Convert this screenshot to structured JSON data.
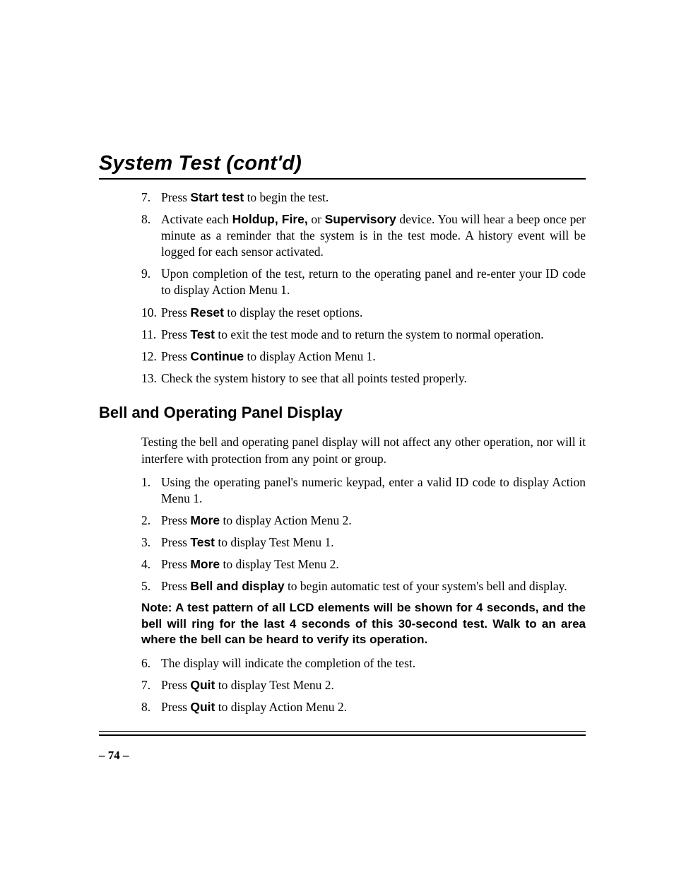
{
  "title": "System Test (cont'd)",
  "list1": {
    "items": [
      {
        "num": "7.",
        "parts": [
          "Press ",
          "Start test",
          " to begin the test."
        ]
      },
      {
        "num": "8.",
        "parts": [
          "Activate each ",
          "Holdup, Fire,",
          " or ",
          "Supervisory",
          " device. You will hear a beep once per minute as a reminder that the system is in the test mode. A history event will be logged for each sensor activated."
        ]
      },
      {
        "num": "9.",
        "parts": [
          "Upon completion of the test, return to the operating panel and re-enter your ID code to display Action Menu 1."
        ]
      },
      {
        "num": "10.",
        "parts": [
          "Press ",
          "Reset",
          " to display the reset options."
        ]
      },
      {
        "num": "11.",
        "parts": [
          "Press ",
          "Test",
          " to exit the test mode and to return the system to normal operation."
        ]
      },
      {
        "num": "12.",
        "parts": [
          "Press ",
          "Continue",
          " to display Action Menu 1."
        ]
      },
      {
        "num": "13.",
        "parts": [
          "Check the system history to see that all points tested properly."
        ]
      }
    ]
  },
  "section2_head": "Bell and Operating Panel Display",
  "section2_para": "Testing the bell and operating panel display will not affect any other operation, nor will it interfere with protection from any point or group.",
  "list2a": {
    "items": [
      {
        "num": "1.",
        "parts": [
          "Using the operating panel's numeric keypad, enter a valid ID code to display Action Menu 1."
        ]
      },
      {
        "num": "2.",
        "parts": [
          "Press ",
          "More",
          " to display Action Menu 2."
        ]
      },
      {
        "num": "3.",
        "parts": [
          "Press ",
          "Test",
          " to display Test Menu 1."
        ]
      },
      {
        "num": "4.",
        "parts": [
          "Press ",
          "More",
          " to display Test Menu 2."
        ]
      },
      {
        "num": "5.",
        "parts": [
          "Press ",
          "Bell and display",
          " to begin automatic test of your system's bell and display."
        ]
      }
    ]
  },
  "note": "Note: A test pattern of all LCD elements will be shown for 4 seconds, and the bell will ring for the last 4 seconds of this 30-second test. Walk to an area where the bell can be heard to verify its operation.",
  "list2b": {
    "items": [
      {
        "num": "6.",
        "parts": [
          "The display will indicate the completion of the test."
        ]
      },
      {
        "num": "7.",
        "parts": [
          "Press ",
          "Quit",
          " to display Test Menu 2."
        ]
      },
      {
        "num": "8.",
        "parts": [
          "Press ",
          "Quit",
          " to display Action Menu 2."
        ]
      }
    ]
  },
  "page_num": "– 74 –"
}
